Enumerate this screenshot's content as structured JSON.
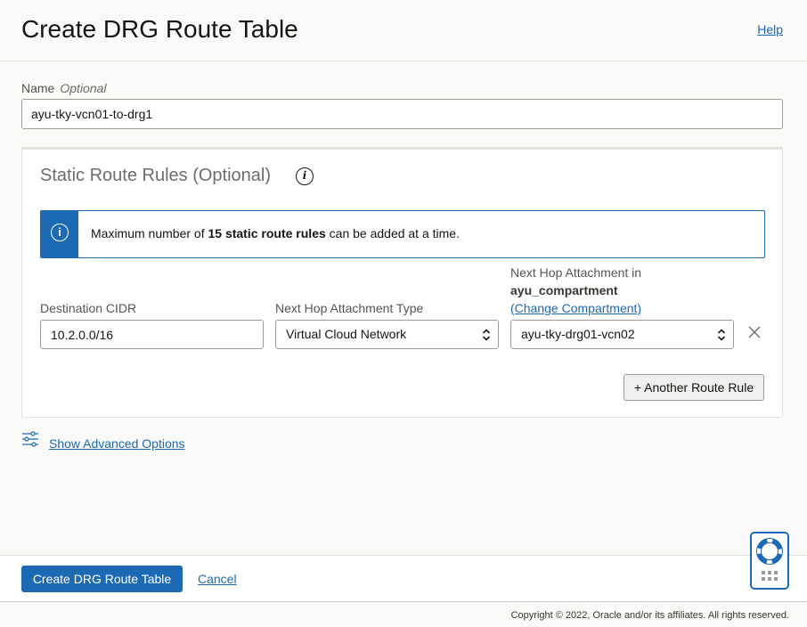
{
  "header": {
    "title": "Create DRG Route Table",
    "help_label": "Help"
  },
  "name_field": {
    "label": "Name",
    "optional_label": "Optional",
    "value": "ayu-tky-vcn01-to-drg1"
  },
  "static_rules": {
    "title": "Static Route Rules (Optional)",
    "info_banner": {
      "prefix": "Maximum number of ",
      "bold": "15 static route rules",
      "suffix": " can be added at a time."
    },
    "columns": {
      "destination_label": "Destination CIDR",
      "type_label": "Next Hop Attachment Type",
      "attachment_label": "Next Hop Attachment in",
      "compartment_name": "ayu_compartment",
      "change_compartment_label": "(Change Compartment)"
    },
    "rules": [
      {
        "destination": "10.2.0.0/16",
        "type": "Virtual Cloud Network",
        "attachment": "ayu-tky-drg01-vcn02"
      }
    ],
    "add_rule_label": "+ Another Route Rule"
  },
  "advanced": {
    "label": "Show Advanced Options"
  },
  "footer": {
    "create_label": "Create DRG Route Table",
    "cancel_label": "Cancel"
  },
  "copyright": "Copyright © 2022, Oracle and/or its affiliates. All rights reserved.",
  "icons": [
    "info-icon",
    "close-icon",
    "sliders-icon",
    "chevron-updown-icon",
    "lifebuoy-icon"
  ],
  "colors": {
    "accent": "#1d6ab4",
    "background": "#f9f9f8"
  }
}
